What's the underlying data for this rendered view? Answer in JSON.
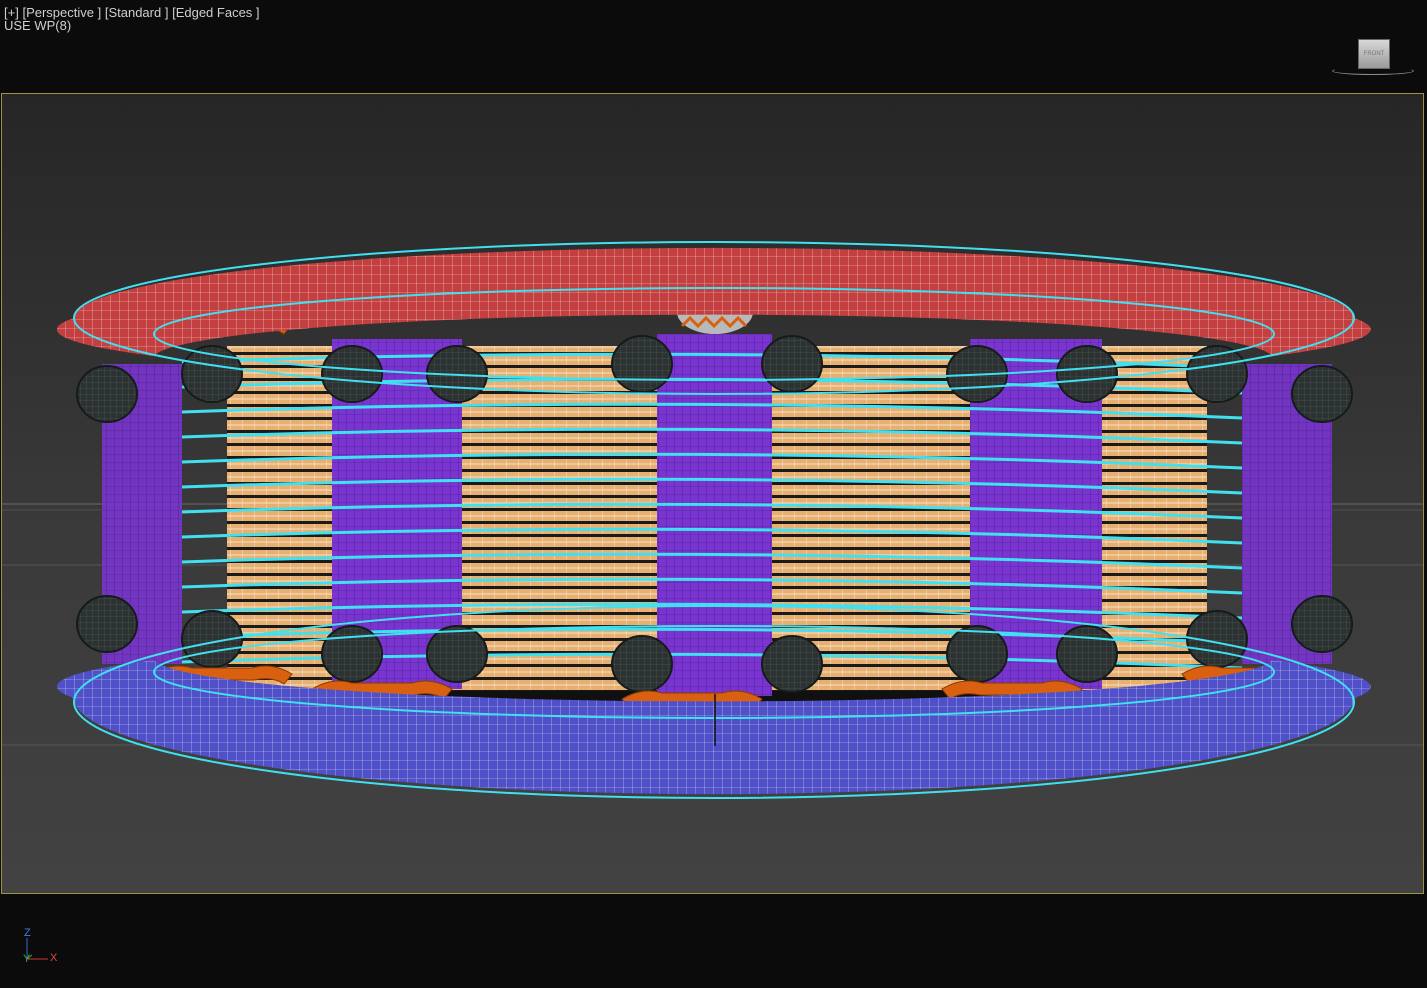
{
  "viewport": {
    "labels": {
      "menu": "[+]",
      "pov": "[Perspective ]",
      "shading": "[Standard ]",
      "display": "[Edged Faces ]",
      "workplane": "USE WP(8)"
    },
    "viewcube": {
      "face": "FRONT"
    },
    "axis_tripod": {
      "z": "Z",
      "y": "Y",
      "x": "X"
    }
  },
  "colors": {
    "top_torus": "#c44040",
    "bottom_torus": "#5050c8",
    "coil_panel": "#7030c8",
    "copper_winding": "#e8b070",
    "bracket": "#d86010",
    "highlight_cyan": "#40e0f0",
    "safe_frame": "#9c9440"
  },
  "icons": [
    "viewcube-icon",
    "axis-tripod-icon"
  ]
}
